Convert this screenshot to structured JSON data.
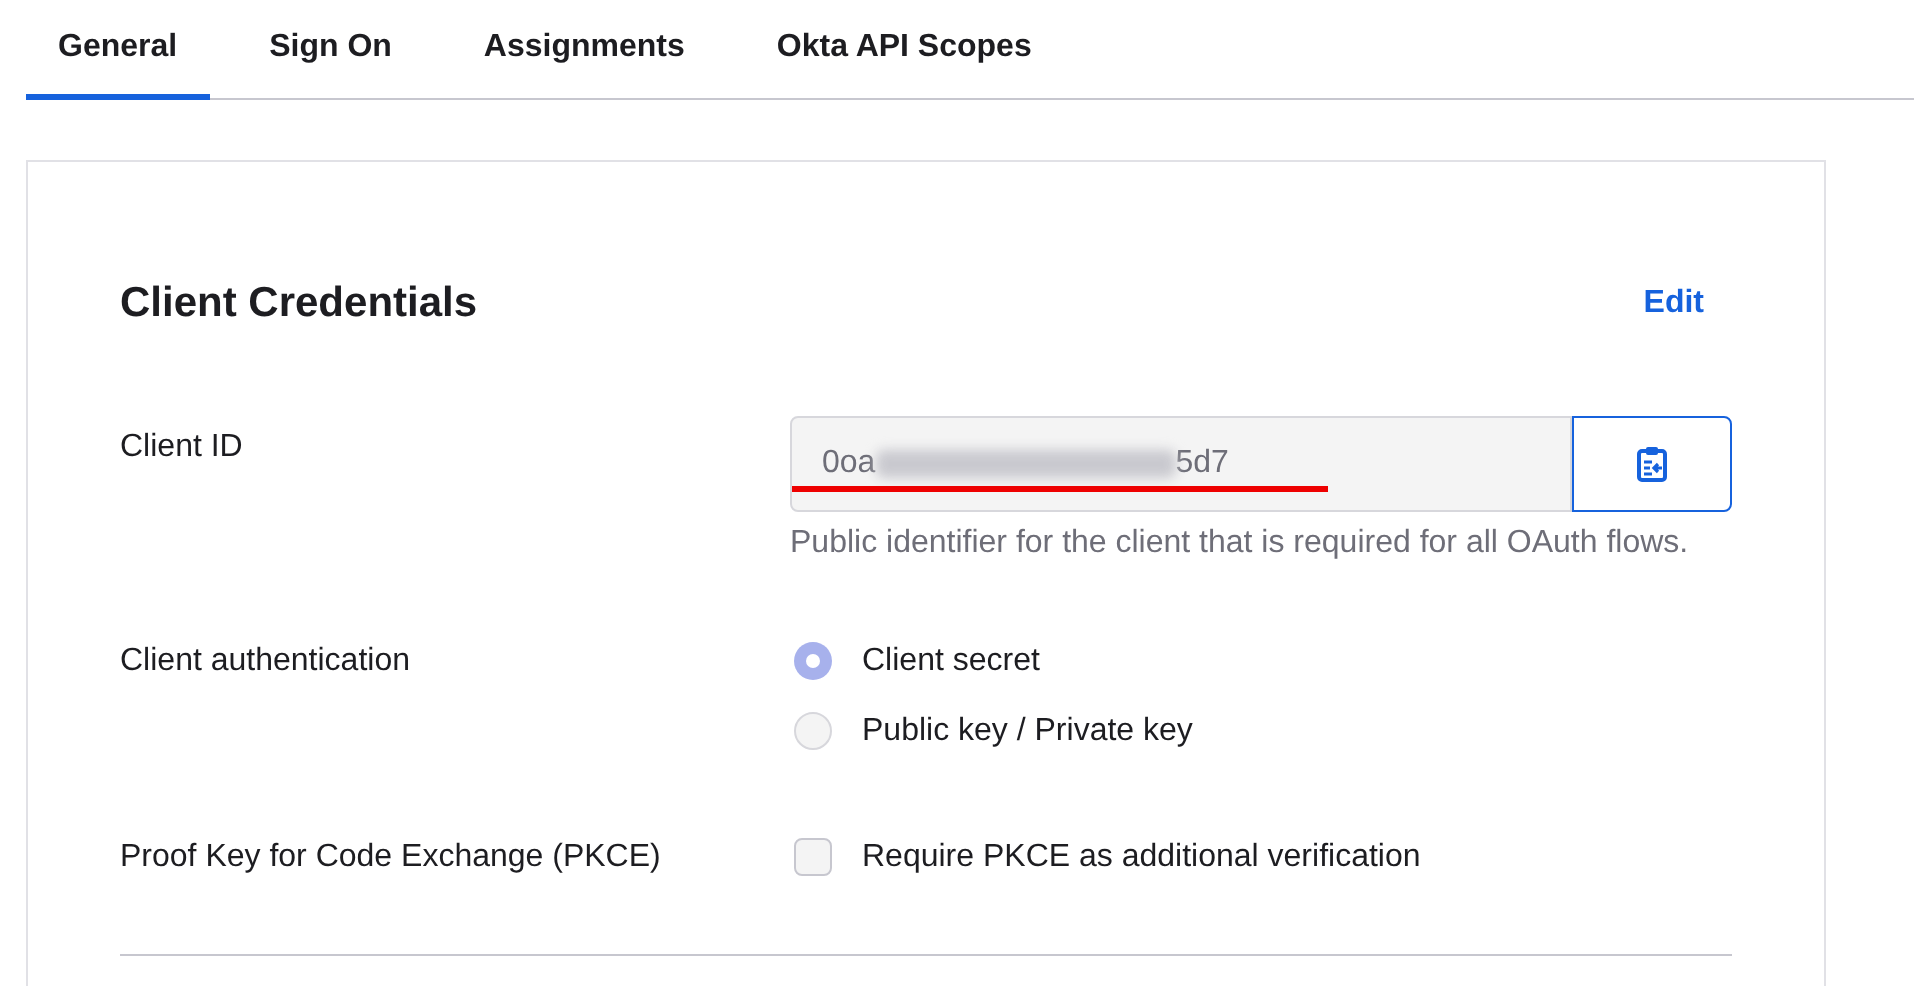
{
  "tabs": [
    {
      "label": "General",
      "selected": true
    },
    {
      "label": "Sign On",
      "selected": false
    },
    {
      "label": "Assignments",
      "selected": false
    },
    {
      "label": "Okta API Scopes",
      "selected": false
    }
  ],
  "card": {
    "title": "Client Credentials",
    "edit_link": "Edit",
    "client_id": {
      "label": "Client ID",
      "value_start": "0oa",
      "value_end": "5d7",
      "redacted": true,
      "underlined": true,
      "help": "Public identifier for the client that is required for all OAuth flows."
    },
    "client_authentication": {
      "label": "Client authentication",
      "options": [
        {
          "label": "Client secret",
          "selected": true
        },
        {
          "label": "Public key / Private key",
          "selected": false
        }
      ]
    },
    "pkce": {
      "label": "Proof Key for Code Exchange (PKCE)",
      "option": "Require PKCE as additional verification",
      "checked": false
    }
  }
}
